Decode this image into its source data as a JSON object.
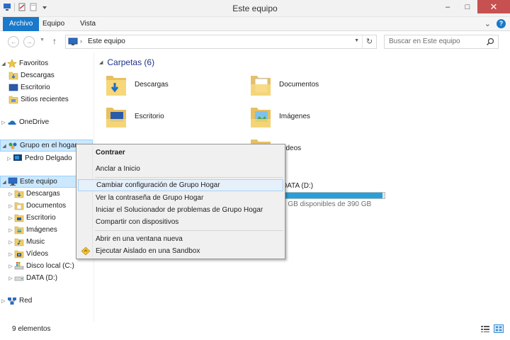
{
  "window": {
    "title": "Este equipo",
    "minimize_glyph": "–",
    "maximize_glyph": "□",
    "close_glyph": "✕"
  },
  "ribbon": {
    "tabs": [
      {
        "label": "Archivo",
        "active": true
      },
      {
        "label": "Equipo"
      },
      {
        "label": "Vista"
      }
    ],
    "collapse_glyph": "⌄",
    "help_glyph": "?"
  },
  "address": {
    "back_glyph": "←",
    "forward_glyph": "→",
    "up_glyph": "↑",
    "location": "Este equipo",
    "refresh_glyph": "↻"
  },
  "search": {
    "placeholder": "Buscar en Este equipo"
  },
  "nav": {
    "items": [
      {
        "label": "Favoritos",
        "icon": "star-icon"
      },
      {
        "label": "Descargas",
        "icon": "downloads-folder-icon"
      },
      {
        "label": "Escritorio",
        "icon": "desktop-icon"
      },
      {
        "label": "Sitios recientes",
        "icon": "recent-places-icon"
      },
      {
        "label": "OneDrive",
        "icon": "onedrive-icon"
      },
      {
        "label": "Grupo en el hogar",
        "icon": "homegroup-icon"
      },
      {
        "label": "Pedro Delgado",
        "icon": "user-pc-icon"
      },
      {
        "label": "Este equipo",
        "icon": "computer-icon"
      },
      {
        "label": "Descargas",
        "icon": "downloads-folder-icon"
      },
      {
        "label": "Documentos",
        "icon": "documents-folder-icon"
      },
      {
        "label": "Escritorio",
        "icon": "desktop-folder-icon"
      },
      {
        "label": "Imágenes",
        "icon": "pictures-folder-icon"
      },
      {
        "label": "Music",
        "icon": "music-folder-icon"
      },
      {
        "label": "Vídeos",
        "icon": "videos-folder-icon"
      },
      {
        "label": "Disco local (C:)",
        "icon": "local-disk-icon"
      },
      {
        "label": "DATA (D:)",
        "icon": "drive-icon"
      },
      {
        "label": "Red",
        "icon": "network-icon"
      }
    ]
  },
  "content": {
    "group_title": "Carpetas (6)",
    "folders": [
      {
        "label": "Descargas"
      },
      {
        "label": "Documentos"
      },
      {
        "label": "Escritorio"
      },
      {
        "label": "Imágenes"
      },
      {
        "label": "Vídeos"
      }
    ],
    "drive": {
      "label": "DATA (D:)",
      "free_text": "6 GB disponibles de 390 GB",
      "used_fraction": 0.98
    }
  },
  "context_menu": {
    "items": [
      {
        "label": "Contraer",
        "bold": true
      },
      {
        "label": "Anclar a Inicio"
      },
      {
        "label": "Cambiar configuración de Grupo Hogar",
        "highlighted": true
      },
      {
        "label": "Ver la contraseña de Grupo Hogar"
      },
      {
        "label": "Iniciar el Solucionador de problemas de Grupo Hogar"
      },
      {
        "label": "Compartir con dispositivos"
      },
      {
        "label": "Abrir en una ventana nueva"
      },
      {
        "label": "Ejecutar Aislado en una Sandbox",
        "icon": "sandbox-icon"
      }
    ]
  },
  "status": {
    "text": "9 elementos"
  },
  "colors": {
    "accent": "#1979ca",
    "selection": "#cce8ff",
    "close": "#c75050",
    "drive_fill": "#26a0da"
  }
}
